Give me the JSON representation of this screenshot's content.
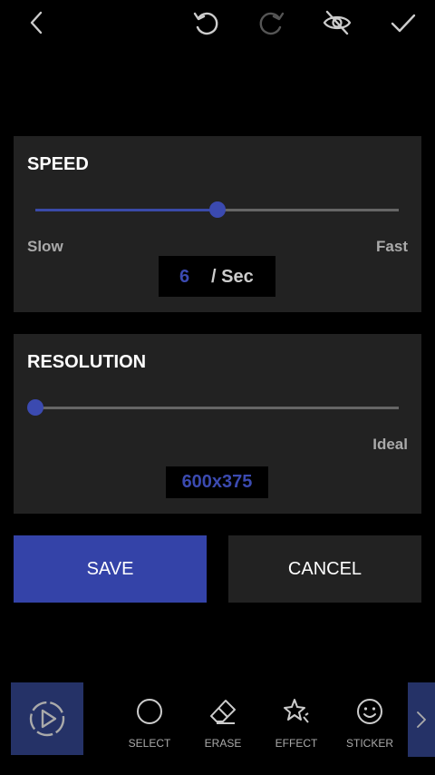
{
  "topbar": {
    "icons": [
      "back-icon",
      "undo-icon",
      "redo-icon",
      "hide-preview-icon",
      "confirm-check-icon"
    ]
  },
  "speed": {
    "title": "SPEED",
    "min_label": "Slow",
    "max_label": "Fast",
    "value": "6",
    "unit": "/ Sec",
    "slider_fraction": 0.5
  },
  "resolution": {
    "title": "RESOLUTION",
    "max_label": "Ideal",
    "value": "600x375",
    "slider_fraction": 0.0
  },
  "buttons": {
    "save": "SAVE",
    "cancel": "CANCEL"
  },
  "toolbar": {
    "tools": [
      {
        "label": "SELECT",
        "icon": "circle-select-icon"
      },
      {
        "label": "ERASE",
        "icon": "eraser-icon"
      },
      {
        "label": "EFFECT",
        "icon": "sparkle-star-icon"
      },
      {
        "label": "STICKER",
        "icon": "smiley-icon"
      }
    ],
    "play_icon": "play-preview-icon",
    "more_icon": "chevron-right-icon"
  },
  "colors": {
    "accent": "#3443a8",
    "panel": "#222222",
    "background": "#000000"
  }
}
